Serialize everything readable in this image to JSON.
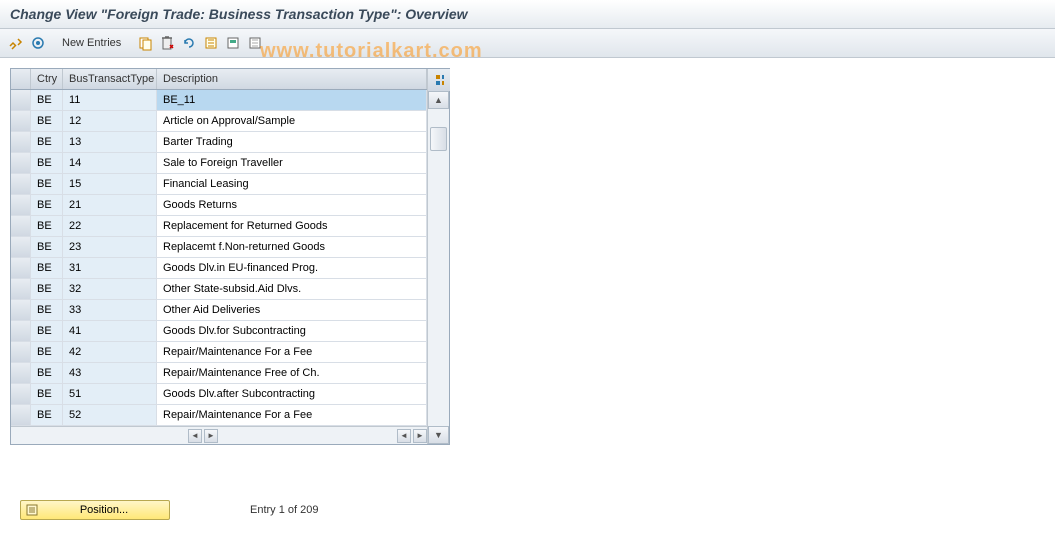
{
  "header": {
    "title": "Change View \"Foreign Trade: Business Transaction Type\": Overview"
  },
  "toolbar": {
    "new_entries_label": "New Entries"
  },
  "table": {
    "columns": {
      "ctry": "Ctry",
      "btt": "BusTransactType",
      "desc": "Description"
    },
    "rows": [
      {
        "ctry": "BE",
        "btt": "11",
        "desc": "BE_11",
        "selected": true
      },
      {
        "ctry": "BE",
        "btt": "12",
        "desc": "Article on Approval/Sample"
      },
      {
        "ctry": "BE",
        "btt": "13",
        "desc": "Barter Trading"
      },
      {
        "ctry": "BE",
        "btt": "14",
        "desc": "Sale to Foreign Traveller"
      },
      {
        "ctry": "BE",
        "btt": "15",
        "desc": "Financial Leasing"
      },
      {
        "ctry": "BE",
        "btt": "21",
        "desc": "Goods Returns"
      },
      {
        "ctry": "BE",
        "btt": "22",
        "desc": "Replacement for Returned Goods"
      },
      {
        "ctry": "BE",
        "btt": "23",
        "desc": "Replacemt f.Non-returned Goods"
      },
      {
        "ctry": "BE",
        "btt": "31",
        "desc": "Goods Dlv.in EU-financed Prog."
      },
      {
        "ctry": "BE",
        "btt": "32",
        "desc": "Other State-subsid.Aid Dlvs."
      },
      {
        "ctry": "BE",
        "btt": "33",
        "desc": "Other Aid Deliveries"
      },
      {
        "ctry": "BE",
        "btt": "41",
        "desc": "Goods Dlv.for Subcontracting"
      },
      {
        "ctry": "BE",
        "btt": "42",
        "desc": "Repair/Maintenance For a Fee"
      },
      {
        "ctry": "BE",
        "btt": "43",
        "desc": "Repair/Maintenance Free of Ch."
      },
      {
        "ctry": "BE",
        "btt": "51",
        "desc": "Goods Dlv.after Subcontracting"
      },
      {
        "ctry": "BE",
        "btt": "52",
        "desc": "Repair/Maintenance For a Fee"
      }
    ]
  },
  "footer": {
    "position_label": "Position...",
    "entry_info": "Entry 1 of 209"
  },
  "watermark": "www.tutorialkart.com"
}
